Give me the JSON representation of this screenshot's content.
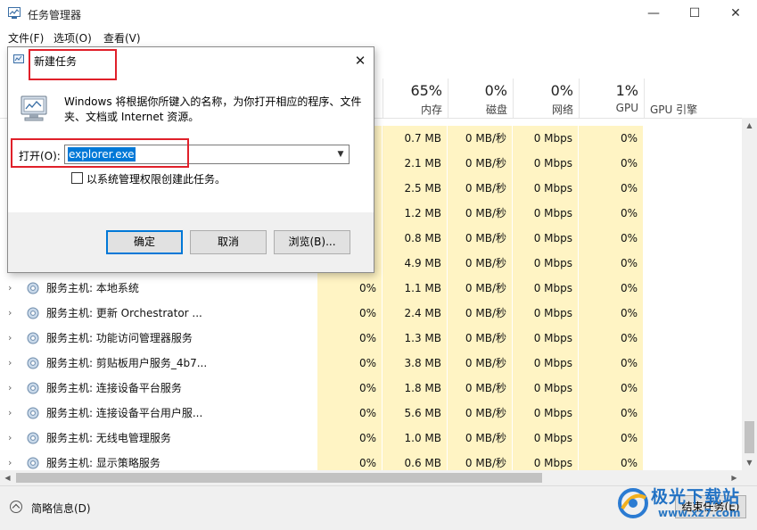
{
  "taskmanager": {
    "title": "任务管理器",
    "window_controls": {
      "minimize": "—",
      "maximize": "☐",
      "close": "✕"
    },
    "menu": [
      "文件(F)",
      "选项(O)",
      "查看(V)"
    ],
    "columns": [
      {
        "pct": "",
        "label": ""
      },
      {
        "pct": "65%",
        "label": "内存"
      },
      {
        "pct": "0%",
        "label": "磁盘"
      },
      {
        "pct": "0%",
        "label": "网络"
      },
      {
        "pct": "1%",
        "label": "GPU"
      }
    ],
    "gpu_engine_label": "GPU 引擎",
    "rows": [
      {
        "name": "",
        "cpu": "",
        "mem": "0.7 MB",
        "disk": "0 MB/秒",
        "net": "0 Mbps",
        "gpu": "0%"
      },
      {
        "name": "",
        "cpu": "",
        "mem": "2.1 MB",
        "disk": "0 MB/秒",
        "net": "0 Mbps",
        "gpu": "0%"
      },
      {
        "name": "",
        "cpu": "",
        "mem": "2.5 MB",
        "disk": "0 MB/秒",
        "net": "0 Mbps",
        "gpu": "0%"
      },
      {
        "name": "",
        "cpu": "",
        "mem": "1.2 MB",
        "disk": "0 MB/秒",
        "net": "0 Mbps",
        "gpu": "0%"
      },
      {
        "name": "",
        "cpu": "",
        "mem": "0.8 MB",
        "disk": "0 MB/秒",
        "net": "0 Mbps",
        "gpu": "0%"
      },
      {
        "name": "",
        "cpu": "",
        "mem": "4.9 MB",
        "disk": "0 MB/秒",
        "net": "0 Mbps",
        "gpu": "0%"
      },
      {
        "name": "服务主机: 本地系统",
        "cpu": "0%",
        "mem": "1.1 MB",
        "disk": "0 MB/秒",
        "net": "0 Mbps",
        "gpu": "0%"
      },
      {
        "name": "服务主机: 更新 Orchestrator ...",
        "cpu": "0%",
        "mem": "2.4 MB",
        "disk": "0 MB/秒",
        "net": "0 Mbps",
        "gpu": "0%"
      },
      {
        "name": "服务主机: 功能访问管理器服务",
        "cpu": "0%",
        "mem": "1.3 MB",
        "disk": "0 MB/秒",
        "net": "0 Mbps",
        "gpu": "0%"
      },
      {
        "name": "服务主机: 剪贴板用户服务_4b7...",
        "cpu": "0%",
        "mem": "3.8 MB",
        "disk": "0 MB/秒",
        "net": "0 Mbps",
        "gpu": "0%"
      },
      {
        "name": "服务主机: 连接设备平台服务",
        "cpu": "0%",
        "mem": "1.8 MB",
        "disk": "0 MB/秒",
        "net": "0 Mbps",
        "gpu": "0%"
      },
      {
        "name": "服务主机: 连接设备平台用户服...",
        "cpu": "0%",
        "mem": "5.6 MB",
        "disk": "0 MB/秒",
        "net": "0 Mbps",
        "gpu": "0%"
      },
      {
        "name": "服务主机: 无线电管理服务",
        "cpu": "0%",
        "mem": "1.0 MB",
        "disk": "0 MB/秒",
        "net": "0 Mbps",
        "gpu": "0%"
      },
      {
        "name": "服务主机: 显示策略服务",
        "cpu": "0%",
        "mem": "0.6 MB",
        "disk": "0 MB/秒",
        "net": "0 Mbps",
        "gpu": "0%"
      }
    ],
    "footer": {
      "less_details": "简略信息(D)",
      "end_task": "结束任务(E)"
    }
  },
  "dialog": {
    "title": "新建任务",
    "close_glyph": "✕",
    "description": "Windows 将根据你所键入的名称，为你打开相应的程序、文件夹、文档或 Internet 资源。",
    "open_label": "打开(O):",
    "open_value": "explorer.exe",
    "admin_label": "以系统管理权限创建此任务。",
    "admin_checked": false,
    "ok": "确定",
    "cancel": "取消",
    "browse": "浏览(B)..."
  },
  "watermark": {
    "text": "极光下载站",
    "url": "www.xz7.com"
  },
  "colors": {
    "highlight_cell": "#fff4c4",
    "selection": "#0078d7",
    "annotation_red": "#e0202a"
  }
}
